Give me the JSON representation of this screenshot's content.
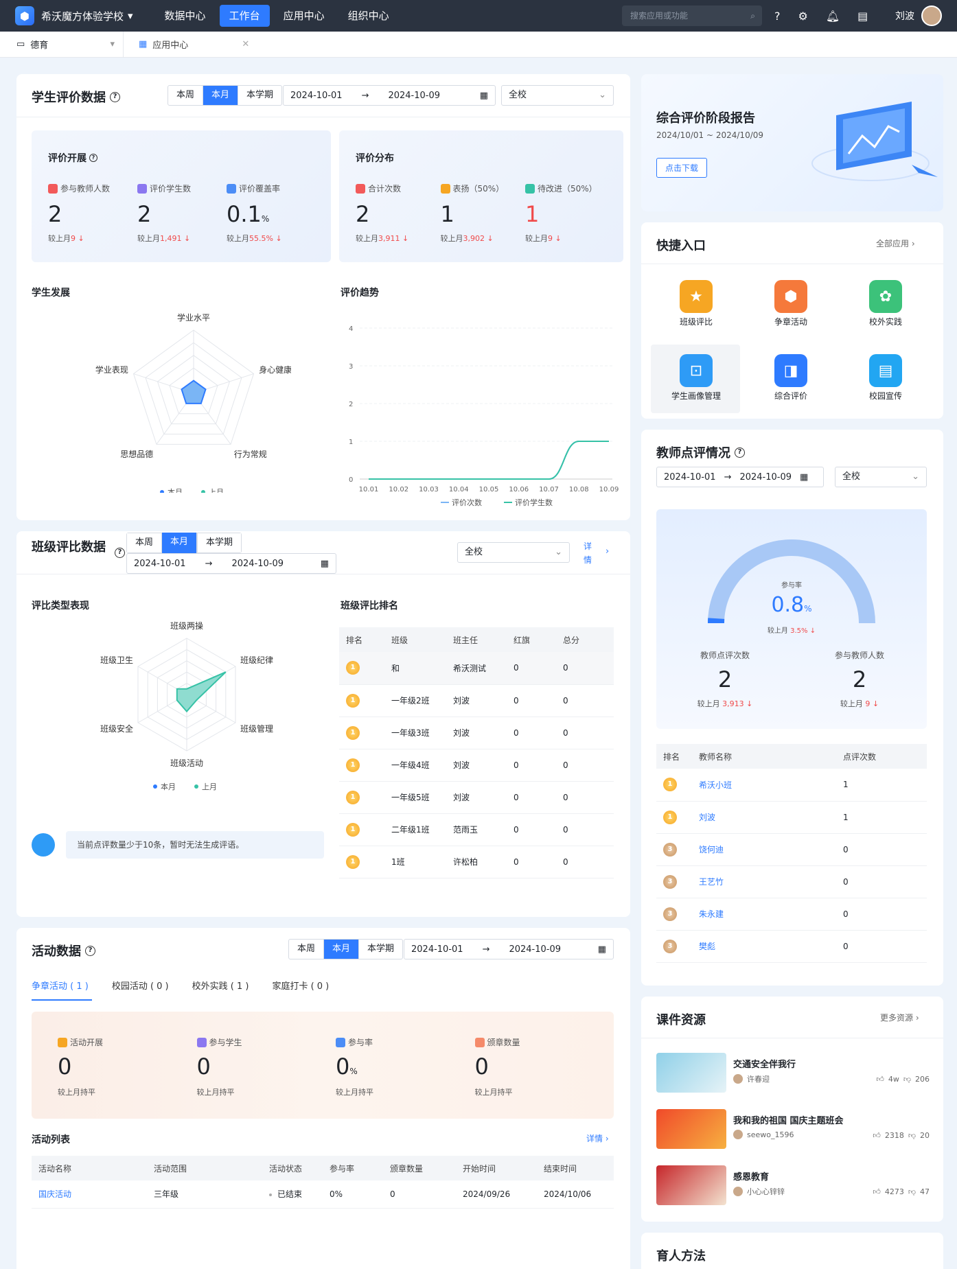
{
  "topbar": {
    "school": "希沃魔方体验学校",
    "nav": [
      "数据中心",
      "工作台",
      "应用中心",
      "组织中心"
    ],
    "active_nav": 1,
    "search_placeholder": "搜索应用或功能",
    "user": "刘波"
  },
  "tabs": {
    "tab1": "德育",
    "tab2": "应用中心"
  },
  "eval": {
    "title": "学生评价数据",
    "seg": [
      "本周",
      "本月",
      "本学期"
    ],
    "date_from": "2024-10-01",
    "date_to": "2024-10-09",
    "scope": "全校",
    "dev": {
      "title": "评价开展",
      "items": [
        {
          "label": "参与教师人数",
          "value": "2",
          "cmp_label": "较上月",
          "cmp": "9"
        },
        {
          "label": "评价学生数",
          "value": "2",
          "cmp_label": "较上月",
          "cmp": "1,491"
        },
        {
          "label": "评价覆盖率",
          "value": "0.1",
          "unit": "%",
          "cmp_label": "较上月",
          "cmp": "55.5%"
        }
      ]
    },
    "dist": {
      "title": "评价分布",
      "items": [
        {
          "label": "合计次数",
          "value": "2",
          "cmp_label": "较上月",
          "cmp": "3,911"
        },
        {
          "label": "表扬（50%）",
          "value": "1",
          "cmp_label": "较上月",
          "cmp": "3,902"
        },
        {
          "label": "待改进（50%）",
          "value": "1",
          "cmp_label": "较上月",
          "cmp": "9"
        }
      ]
    },
    "radar_title": "学生发展",
    "radar_axes": [
      "学业水平",
      "身心健康",
      "行为常规",
      "思想品德",
      "学业表现"
    ],
    "legend": [
      "本月",
      "上月"
    ],
    "trend_title": "评价趋势",
    "trend_legend": [
      "评价次数",
      "评价学生数"
    ]
  },
  "class": {
    "title": "班级评比数据",
    "seg": [
      "本周",
      "本月",
      "本学期"
    ],
    "date_from": "2024-10-01",
    "date_to": "2024-10-09",
    "scope": "全校",
    "detail": "详情",
    "radar_title": "评比类型表现",
    "radar_axes": [
      "班级两操",
      "班级纪律",
      "班级管理",
      "班级活动",
      "班级安全",
      "班级卫生"
    ],
    "legend": [
      "本月",
      "上月"
    ],
    "tip": "当前点评数量少于10条，暂时无法生成评语。",
    "rank_title": "班级评比排名",
    "cols": [
      "排名",
      "班级",
      "班主任",
      "红旗",
      "总分"
    ],
    "rows": [
      [
        "1",
        "和",
        "希沃测试",
        "0",
        "0"
      ],
      [
        "1",
        "一年级2班",
        "刘波",
        "0",
        "0"
      ],
      [
        "1",
        "一年级3班",
        "刘波",
        "0",
        "0"
      ],
      [
        "1",
        "一年级4班",
        "刘波",
        "0",
        "0"
      ],
      [
        "1",
        "一年级5班",
        "刘波",
        "0",
        "0"
      ],
      [
        "1",
        "二年级1班",
        "范雨玉",
        "0",
        "0"
      ],
      [
        "1",
        "1班",
        "许松柏",
        "0",
        "0"
      ]
    ]
  },
  "activity": {
    "title": "活动数据",
    "seg": [
      "本周",
      "本月",
      "本学期"
    ],
    "date_from": "2024-10-01",
    "date_to": "2024-10-09",
    "tabs": [
      "争章活动 ( 1 )",
      "校园活动 ( 0 )",
      "校外实践 ( 1 )",
      "家庭打卡 ( 0 )"
    ],
    "stats": [
      {
        "label": "活动开展",
        "value": "0",
        "cmp": "较上月持平"
      },
      {
        "label": "参与学生",
        "value": "0",
        "cmp": "较上月持平"
      },
      {
        "label": "参与率",
        "value": "0",
        "unit": "%",
        "cmp": "较上月持平"
      },
      {
        "label": "颁章数量",
        "value": "0",
        "cmp": "较上月持平"
      }
    ],
    "list_title": "活动列表",
    "detail": "详情",
    "cols": [
      "活动名称",
      "活动范围",
      "活动状态",
      "参与率",
      "颁章数量",
      "开始时间",
      "结束时间"
    ],
    "rows": [
      [
        "国庆活动",
        "三年级",
        "已结束",
        "0%",
        "0",
        "2024/09/26",
        "2024/10/06"
      ]
    ]
  },
  "report": {
    "title": "综合评价阶段报告",
    "range": "2024/10/01 ~ 2024/10/09",
    "button": "点击下载"
  },
  "quick": {
    "title": "快捷入口",
    "all": "全部应用",
    "items": [
      "班级评比",
      "争章活动",
      "校外实践",
      "学生画像管理",
      "综合评价",
      "校园宣传"
    ]
  },
  "teacher": {
    "title": "教师点评情况",
    "date_from": "2024-10-01",
    "date_to": "2024-10-09",
    "scope": "全校",
    "gauge_label": "参与率",
    "gauge_value": "0.8",
    "gauge_unit": "%",
    "gauge_cmp_label": "较上月",
    "gauge_cmp": "3.5%",
    "gauge_fraction": 0.008,
    "s1_label": "教师点评次数",
    "s1_value": "2",
    "s1_cmp_label": "较上月",
    "s1_cmp": "3,913",
    "s2_label": "参与教师人数",
    "s2_value": "2",
    "s2_cmp_label": "较上月",
    "s2_cmp": "9",
    "cols": [
      "排名",
      "教师名称",
      "点评次数"
    ],
    "rows": [
      [
        "1",
        "希沃小班",
        "1"
      ],
      [
        "1",
        "刘波",
        "1"
      ],
      [
        "3",
        "饶何迪",
        "0"
      ],
      [
        "3",
        "王艺竹",
        "0"
      ],
      [
        "3",
        "朱永建",
        "0"
      ],
      [
        "3",
        "樊彪",
        "0"
      ]
    ]
  },
  "course": {
    "title": "课件资源",
    "more": "更多资源",
    "items": [
      {
        "title": "交通安全伴我行",
        "author": "许春迎",
        "likes": "4w",
        "dislikes": "206"
      },
      {
        "title": "我和我的祖国 国庆主题班会",
        "author": "seewo_1596",
        "likes": "2318",
        "dislikes": "20"
      },
      {
        "title": "感恩教育",
        "author": "小心心锌锌",
        "likes": "4273",
        "dislikes": "47"
      }
    ]
  },
  "method": {
    "title": "育人方法"
  },
  "colors": {
    "accent": "#2e7bff",
    "topbar": "#2b3340",
    "teal": "#36c2a6",
    "down": "#f04a4a"
  },
  "chart_data": [
    {
      "type": "radar",
      "title": "学生发展",
      "axes": [
        "学业水平",
        "身心健康",
        "行为常规",
        "思想品德",
        "学业表现"
      ],
      "series": [
        {
          "name": "本月",
          "values": [
            1,
            1,
            1,
            1,
            1
          ]
        },
        {
          "name": "上月",
          "values": [
            0,
            0,
            0,
            0,
            0
          ]
        }
      ],
      "max": 5
    },
    {
      "type": "line",
      "title": "评价趋势",
      "categories": [
        "10.01",
        "10.02",
        "10.03",
        "10.04",
        "10.05",
        "10.06",
        "10.07",
        "10.08",
        "10.09"
      ],
      "series": [
        {
          "name": "评价次数",
          "values": [
            0,
            0,
            0,
            0,
            0,
            0,
            0,
            1,
            1
          ]
        },
        {
          "name": "评价学生数",
          "values": [
            0,
            0,
            0,
            0,
            0,
            0,
            0,
            1,
            1
          ]
        }
      ],
      "ylim": [
        0,
        4
      ],
      "yticks": [
        0,
        1,
        2,
        3,
        4
      ]
    },
    {
      "type": "radar",
      "title": "评比类型表现",
      "axes": [
        "班级两操",
        "班级纪律",
        "班级管理",
        "班级活动",
        "班级安全",
        "班级卫生"
      ],
      "series": [
        {
          "name": "本月",
          "values": [
            0.5,
            4,
            1,
            1.5,
            1,
            1
          ]
        },
        {
          "name": "上月",
          "values": [
            0,
            0,
            0,
            0,
            0,
            0
          ]
        }
      ],
      "max": 5
    }
  ]
}
